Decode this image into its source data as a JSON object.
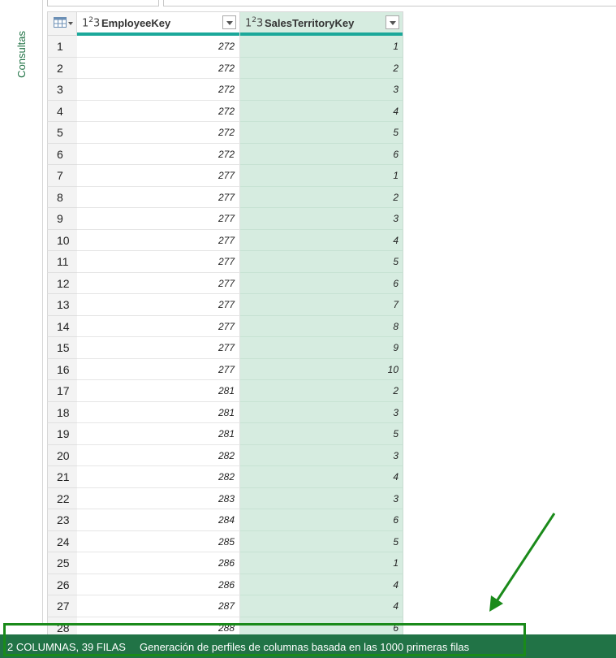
{
  "sidebar": {
    "label": "Consultas"
  },
  "table": {
    "columns": [
      {
        "type_label": "123",
        "name": "EmployeeKey"
      },
      {
        "type_label": "123",
        "name": "SalesTerritoryKey"
      }
    ],
    "rows": [
      [
        "1",
        "272",
        "1"
      ],
      [
        "2",
        "272",
        "2"
      ],
      [
        "3",
        "272",
        "3"
      ],
      [
        "4",
        "272",
        "4"
      ],
      [
        "5",
        "272",
        "5"
      ],
      [
        "6",
        "272",
        "6"
      ],
      [
        "7",
        "277",
        "1"
      ],
      [
        "8",
        "277",
        "2"
      ],
      [
        "9",
        "277",
        "3"
      ],
      [
        "10",
        "277",
        "4"
      ],
      [
        "11",
        "277",
        "5"
      ],
      [
        "12",
        "277",
        "6"
      ],
      [
        "13",
        "277",
        "7"
      ],
      [
        "14",
        "277",
        "8"
      ],
      [
        "15",
        "277",
        "9"
      ],
      [
        "16",
        "277",
        "10"
      ],
      [
        "17",
        "281",
        "2"
      ],
      [
        "18",
        "281",
        "3"
      ],
      [
        "19",
        "281",
        "5"
      ],
      [
        "20",
        "282",
        "3"
      ],
      [
        "21",
        "282",
        "4"
      ],
      [
        "22",
        "283",
        "3"
      ],
      [
        "23",
        "284",
        "6"
      ],
      [
        "24",
        "285",
        "5"
      ],
      [
        "25",
        "286",
        "1"
      ],
      [
        "26",
        "286",
        "4"
      ],
      [
        "27",
        "287",
        "4"
      ],
      [
        "28",
        "288",
        "6"
      ]
    ]
  },
  "status": {
    "summary": "2 COLUMNAS, 39 FILAS",
    "profiling": "Generación de perfiles de columnas basada en las 1000 primeras filas"
  },
  "colors": {
    "accent": "#217346",
    "column_bar": "#1ba89a",
    "selected_column": "#d6ece0",
    "annotation": "#1a8a1a"
  }
}
